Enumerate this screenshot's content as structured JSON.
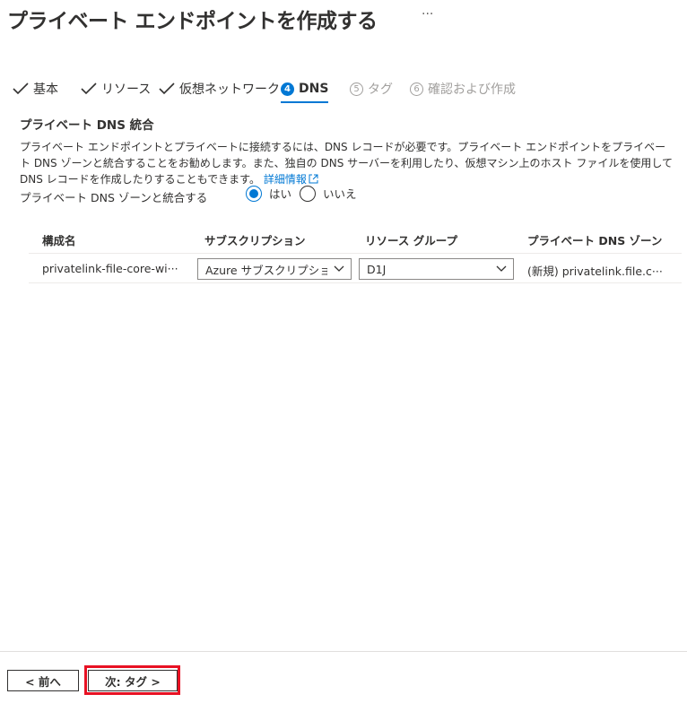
{
  "header": {
    "title": "プライベート エンドポイントを作成する",
    "more": "···"
  },
  "tabs": [
    {
      "label": "基本",
      "state": "done"
    },
    {
      "label": "リソース",
      "state": "done"
    },
    {
      "label": "仮想ネットワーク",
      "state": "done"
    },
    {
      "number": "4",
      "label": "DNS",
      "state": "active"
    },
    {
      "number": "5",
      "label": "タグ",
      "state": "disabled"
    },
    {
      "number": "6",
      "label": "確認および作成",
      "state": "disabled"
    }
  ],
  "section": {
    "title": "プライベート DNS 統合",
    "description": "プライベート エンドポイントとプライベートに接続するには、DNS レコードが必要です。プライベート エンドポイントをプライベート DNS ゾーンと統合することをお勧めします。また、独自の DNS サーバーを利用したり、仮想マシン上のホスト ファイルを使用して DNS レコードを作成したりすることもできます。",
    "learn_more": "詳細情報"
  },
  "integrate": {
    "label": "プライベート DNS ゾーンと統合する",
    "options": [
      "はい",
      "いいえ"
    ],
    "selected": "はい"
  },
  "table": {
    "headers": [
      "構成名",
      "サブスクリプション",
      "リソース グループ",
      "プライベート DNS ゾーン"
    ],
    "rows": [
      {
        "config": "privatelink-file-core-wi···",
        "subscription": "Azure サブスクリプショ···",
        "resource_group": "D1J",
        "zone": "(新規) privatelink.file.c···"
      }
    ]
  },
  "footer": {
    "prev": "< 前へ",
    "next": "次: タグ >"
  },
  "colors": {
    "accent": "#0078d4",
    "highlight": "#e81123"
  }
}
